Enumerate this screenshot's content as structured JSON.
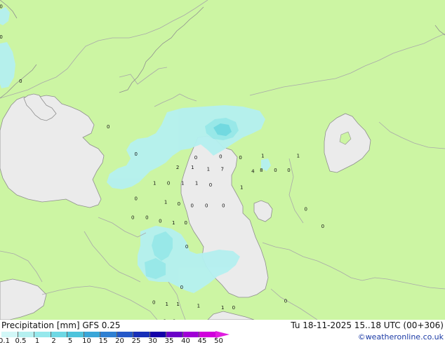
{
  "title": "Precipitation [mm]  GFS 0.25",
  "datetime": "Tu 18-11-2025 15..18 UTC (00+306)",
  "credit": "©weatheronline.co.uk",
  "colors": {
    "land": "#ccf5a3",
    "sea": "#ebebeb",
    "border": "#a9a9a9",
    "coast": "#8f8f8f"
  },
  "legend": {
    "ticks": [
      "0.1",
      "0.5",
      "1",
      "2",
      "5",
      "10",
      "15",
      "20",
      "25",
      "30",
      "35",
      "40",
      "45",
      "50"
    ],
    "colors": [
      "#d2f7f7",
      "#b4f0f0",
      "#96e8ec",
      "#6ed8e4",
      "#4ec4dc",
      "#3aa6d8",
      "#2f80d2",
      "#2458c8",
      "#1830b8",
      "#1400a8",
      "#6a00c8",
      "#a000d6",
      "#d000dc"
    ]
  },
  "labels": [
    {
      "t": "0",
      "lon": 35.06,
      "lat": 45.05
    },
    {
      "t": "0",
      "lon": 35.06,
      "lat": 42.27
    },
    {
      "t": "0",
      "lon": 36.11,
      "lat": 38.23
    },
    {
      "t": "0",
      "lon": 40.82,
      "lat": 34.08
    },
    {
      "t": "0",
      "lon": 42.31,
      "lat": 31.56
    },
    {
      "t": "0",
      "lon": 45.53,
      "lat": 31.24
    },
    {
      "t": "0",
      "lon": 46.86,
      "lat": 31.36
    },
    {
      "t": "0",
      "lon": 47.93,
      "lat": 31.24
    },
    {
      "t": "1",
      "lon": 49.13,
      "lat": 31.4
    },
    {
      "t": "1",
      "lon": 51.03,
      "lat": 31.4
    },
    {
      "t": "2",
      "lon": 44.55,
      "lat": 30.34
    },
    {
      "t": "1",
      "lon": 45.35,
      "lat": 30.34
    },
    {
      "t": "1",
      "lon": 46.2,
      "lat": 30.2
    },
    {
      "t": "7",
      "lon": 46.95,
      "lat": 30.2
    },
    {
      "t": "4",
      "lon": 48.6,
      "lat": 30.0
    },
    {
      "t": "8",
      "lon": 49.05,
      "lat": 30.08
    },
    {
      "t": "0",
      "lon": 49.81,
      "lat": 30.08
    },
    {
      "t": "0",
      "lon": 50.53,
      "lat": 30.08
    },
    {
      "t": "1",
      "lon": 43.31,
      "lat": 28.9
    },
    {
      "t": "0",
      "lon": 44.06,
      "lat": 28.9
    },
    {
      "t": "1",
      "lon": 44.82,
      "lat": 28.9
    },
    {
      "t": "1",
      "lon": 45.57,
      "lat": 28.9
    },
    {
      "t": "0",
      "lon": 46.32,
      "lat": 28.74
    },
    {
      "t": "1",
      "lon": 47.99,
      "lat": 28.52
    },
    {
      "t": "0",
      "lon": 42.31,
      "lat": 27.49
    },
    {
      "t": "1",
      "lon": 43.91,
      "lat": 27.18
    },
    {
      "t": "0",
      "lon": 44.62,
      "lat": 27.02
    },
    {
      "t": "0",
      "lon": 45.33,
      "lat": 26.86
    },
    {
      "t": "0",
      "lon": 46.1,
      "lat": 26.86
    },
    {
      "t": "0",
      "lon": 47.01,
      "lat": 26.86
    },
    {
      "t": "0",
      "lon": 51.44,
      "lat": 26.55
    },
    {
      "t": "0",
      "lon": 42.14,
      "lat": 25.77
    },
    {
      "t": "0",
      "lon": 42.9,
      "lat": 25.77
    },
    {
      "t": "0",
      "lon": 43.62,
      "lat": 25.45
    },
    {
      "t": "1",
      "lon": 44.33,
      "lat": 25.3
    },
    {
      "t": "0",
      "lon": 44.99,
      "lat": 25.3
    },
    {
      "t": "0",
      "lon": 52.35,
      "lat": 24.98
    },
    {
      "t": "0",
      "lon": 45.04,
      "lat": 23.1
    },
    {
      "t": "0",
      "lon": 44.77,
      "lat": 19.4
    },
    {
      "t": "0",
      "lon": 43.27,
      "lat": 18.0
    },
    {
      "t": "1",
      "lon": 43.97,
      "lat": 17.84
    },
    {
      "t": "1",
      "lon": 44.57,
      "lat": 17.84
    },
    {
      "t": "1",
      "lon": 45.67,
      "lat": 17.69
    },
    {
      "t": "1",
      "lon": 46.97,
      "lat": 17.53
    },
    {
      "t": "0",
      "lon": 47.56,
      "lat": 17.53
    },
    {
      "t": "0",
      "lon": 50.36,
      "lat": 18.15
    },
    {
      "t": "2",
      "lon": 43.86,
      "lat": 16.28
    },
    {
      "t": "2",
      "lon": 44.37,
      "lat": 16.28
    },
    {
      "t": "0",
      "lon": 45.02,
      "lat": 16.13
    },
    {
      "t": "0",
      "lon": 46.37,
      "lat": 16.13
    },
    {
      "t": "0",
      "lon": 47.5,
      "lat": 15.81
    },
    {
      "t": "0",
      "lon": 48.3,
      "lat": 15.81
    },
    {
      "t": "0",
      "lon": 45.42,
      "lat": 14.88
    },
    {
      "t": "0",
      "lon": 46.37,
      "lat": 14.88
    },
    {
      "t": "0",
      "lon": 45.87,
      "lat": 13.95
    },
    {
      "t": "0",
      "lon": 46.97,
      "lat": 13.95
    }
  ]
}
